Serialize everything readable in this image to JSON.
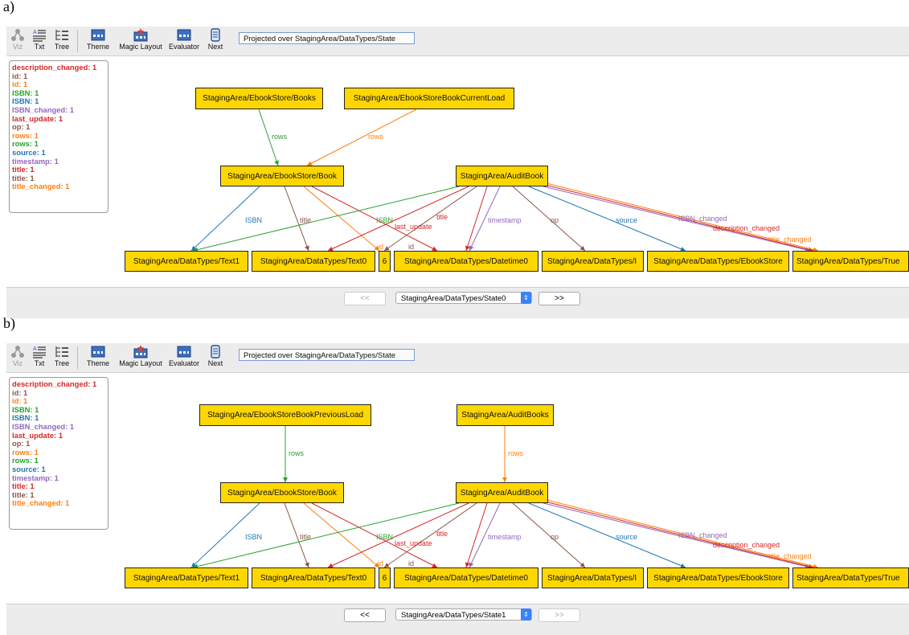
{
  "panels": [
    {
      "label": "a)",
      "toolbar": {
        "viz": "Viz",
        "txt": "Txt",
        "tree": "Tree",
        "theme": "Theme",
        "magic_layout": "Magic Layout",
        "evaluator": "Evaluator",
        "next": "Next",
        "projection": "Projected over StagingArea/DataTypes/State"
      },
      "legend": [
        {
          "text": "description_changed: 1",
          "color": "#d62728"
        },
        {
          "text": "id: 1",
          "color": "#8c564b"
        },
        {
          "text": "id: 1",
          "color": "#ff7f0e"
        },
        {
          "text": "ISBN: 1",
          "color": "#2ca02c"
        },
        {
          "text": "ISBN: 1",
          "color": "#1f77b4"
        },
        {
          "text": "ISBN_changed: 1",
          "color": "#9467bd"
        },
        {
          "text": "last_update: 1",
          "color": "#d62728"
        },
        {
          "text": "op: 1",
          "color": "#8c564b"
        },
        {
          "text": "rows: 1",
          "color": "#ff7f0e"
        },
        {
          "text": "rows: 1",
          "color": "#2ca02c"
        },
        {
          "text": "source: 1",
          "color": "#1f77b4"
        },
        {
          "text": "timestamp: 1",
          "color": "#9467bd"
        },
        {
          "text": "title: 1",
          "color": "#d62728"
        },
        {
          "text": "title: 1",
          "color": "#8c564b"
        },
        {
          "text": "title_changed: 1",
          "color": "#ff7f0e"
        }
      ],
      "nodes": {
        "top_left": "StagingArea/EbookStore/Books",
        "top_right": "StagingArea/EbookStoreBookCurrentLoad",
        "mid_left": "StagingArea/EbookStore/Book",
        "mid_right": "StagingArea/AuditBook",
        "text1": "StagingArea/DataTypes/Text1",
        "text0": "StagingArea/DataTypes/Text0",
        "six": "6",
        "datetime0": "StagingArea/DataTypes/Datetime0",
        "int": "StagingArea/DataTypes/I",
        "ebookstore": "StagingArea/DataTypes/EbookStore",
        "true": "StagingArea/DataTypes/True"
      },
      "edge_labels": {
        "rows_left": "rows",
        "rows_right": "rows",
        "isbn_left": "ISBN",
        "title_left": "title",
        "isbn_right": "ISBN",
        "last_update": "last_update",
        "title_right": "title",
        "timestamp": "timestamp",
        "op": "op",
        "source": "source",
        "isbn_changed": "ISBN_changed",
        "description_changed": "description_changed",
        "title_changed": "title_changed",
        "id_left": "id",
        "id_right": "id"
      },
      "nav": {
        "prev": "<<",
        "next": ">>",
        "state": "StagingArea/DataTypes/State0",
        "prev_enabled": false,
        "next_enabled": true
      }
    },
    {
      "label": "b)",
      "toolbar": {
        "viz": "Viz",
        "txt": "Txt",
        "tree": "Tree",
        "theme": "Theme",
        "magic_layout": "Magic Layout",
        "evaluator": "Evaluator",
        "next": "Next",
        "projection": "Projected over StagingArea/DataTypes/State"
      },
      "legend": [
        {
          "text": "description_changed: 1",
          "color": "#d62728"
        },
        {
          "text": "id: 1",
          "color": "#8c564b"
        },
        {
          "text": "id: 1",
          "color": "#ff7f0e"
        },
        {
          "text": "ISBN: 1",
          "color": "#2ca02c"
        },
        {
          "text": "ISBN: 1",
          "color": "#1f77b4"
        },
        {
          "text": "ISBN_changed: 1",
          "color": "#9467bd"
        },
        {
          "text": "last_update: 1",
          "color": "#d62728"
        },
        {
          "text": "op: 1",
          "color": "#8c564b"
        },
        {
          "text": "rows: 1",
          "color": "#ff7f0e"
        },
        {
          "text": "rows: 1",
          "color": "#2ca02c"
        },
        {
          "text": "source: 1",
          "color": "#1f77b4"
        },
        {
          "text": "timestamp: 1",
          "color": "#9467bd"
        },
        {
          "text": "title: 1",
          "color": "#d62728"
        },
        {
          "text": "title: 1",
          "color": "#8c564b"
        },
        {
          "text": "title_changed: 1",
          "color": "#ff7f0e"
        }
      ],
      "nodes": {
        "top_left": "StagingArea/EbookStoreBookPreviousLoad",
        "top_right": "StagingArea/AuditBooks",
        "mid_left": "StagingArea/EbookStore/Book",
        "mid_right": "StagingArea/AuditBook",
        "text1": "StagingArea/DataTypes/Text1",
        "text0": "StagingArea/DataTypes/Text0",
        "six": "6",
        "datetime0": "StagingArea/DataTypes/Datetime0",
        "int": "StagingArea/DataTypes/I",
        "ebookstore": "StagingArea/DataTypes/EbookStore",
        "true": "StagingArea/DataTypes/True"
      },
      "edge_labels": {
        "rows_left": "rows",
        "rows_right": "rows",
        "isbn_left": "ISBN",
        "title_left": "title",
        "isbn_right": "ISBN",
        "last_update": "last_update",
        "title_right": "title",
        "timestamp": "timestamp",
        "op": "op",
        "source": "source",
        "isbn_changed": "ISBN_changed",
        "description_changed": "description_changed",
        "title_changed": "title_changed",
        "id_left": "id",
        "id_right": "id"
      },
      "nav": {
        "prev": "<<",
        "next": ">>",
        "state": "StagingArea/DataTypes/State1",
        "prev_enabled": true,
        "next_enabled": false
      }
    }
  ],
  "colors": {
    "node_fill": "#ffd700",
    "green": "#2ca02c",
    "orange": "#ff7f0e",
    "blue": "#1f77b4",
    "red": "#d62728",
    "brown": "#8c564b",
    "purple": "#9467bd"
  }
}
